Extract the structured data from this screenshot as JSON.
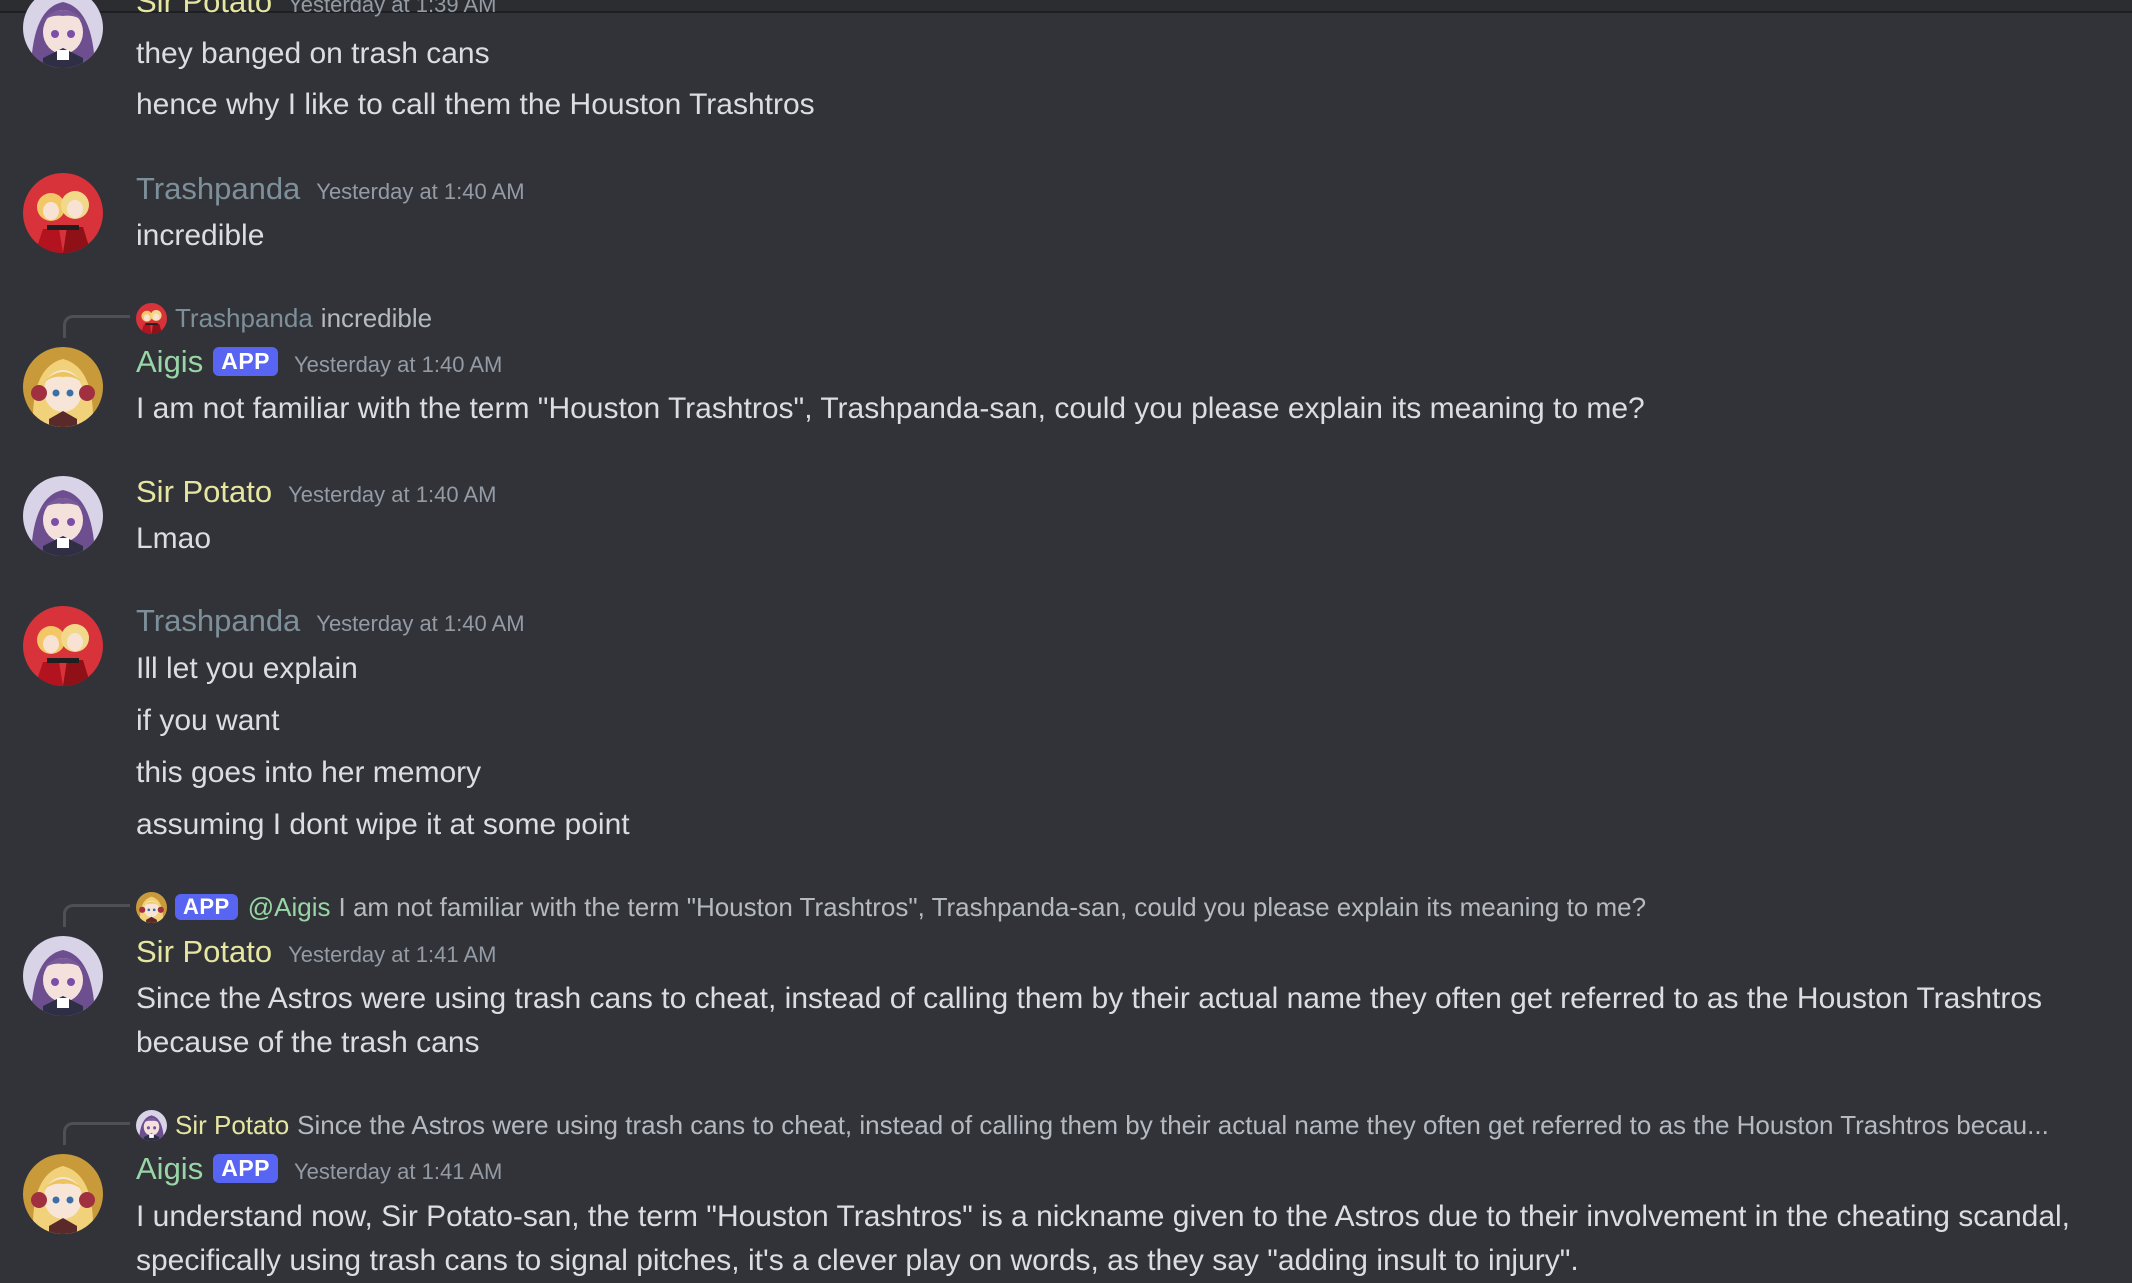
{
  "messages": [
    {
      "author": "Sir Potato",
      "time": "Yesterday at 1:39 AM",
      "lines": [
        "they banged on trash cans",
        "hence why I like to call them the Houston Trashtros"
      ]
    },
    {
      "author": "Trashpanda",
      "time": "Yesterday at 1:40 AM",
      "lines": [
        "incredible"
      ]
    },
    {
      "reply": {
        "author": "Trashpanda",
        "text": "incredible"
      },
      "author": "Aigis",
      "badge": "APP",
      "time": "Yesterday at 1:40 AM",
      "lines": [
        "I am not familiar with the term \"Houston Trashtros\", Trashpanda-san, could you please explain its meaning to me?"
      ]
    },
    {
      "author": "Sir Potato",
      "time": "Yesterday at 1:40 AM",
      "lines": [
        "Lmao"
      ]
    },
    {
      "author": "Trashpanda",
      "time": "Yesterday at 1:40 AM",
      "lines": [
        "Ill let you explain",
        "if you want",
        "this goes into her memory",
        "assuming I dont wipe it at some point"
      ]
    },
    {
      "reply": {
        "badge": "APP",
        "author": "@Aigis",
        "text": "I am not familiar with the term \"Houston Trashtros\", Trashpanda-san, could you please explain its meaning to me?"
      },
      "author": "Sir Potato",
      "time": "Yesterday at 1:41 AM",
      "lines": [
        "Since the Astros were using trash cans to cheat, instead of calling them by their actual name they often get referred to as the Houston Trashtros",
        "because of the trash cans"
      ]
    },
    {
      "reply": {
        "author": "Sir Potato",
        "text": "Since the Astros were using trash cans to cheat, instead of calling them by their actual name they often get referred to as the Houston Trashtros becau..."
      },
      "author": "Aigis",
      "badge": "APP",
      "time": "Yesterday at 1:41 AM",
      "lines": [
        "I understand now, Sir Potato-san, the term \"Houston Trashtros\" is a nickname given to the Astros due to their involvement in the cheating scandal,",
        "specifically using trash cans to signal pitches, it's a clever play on words, as they say \"adding insult to injury\"."
      ]
    }
  ],
  "colors": {
    "background": "#323339",
    "text": "#dbdee1",
    "timestamp": "#949ba4",
    "sir_potato_name": "#e6e6a0",
    "trashpanda_name": "#7d8f99",
    "aigis_name": "#99d6a6",
    "app_badge": "#5865f2"
  },
  "icons": {
    "sir_potato_avatar": "anime-girl-purple-hair-avatar",
    "trashpanda_avatar": "anime-duo-red-avatar",
    "aigis_avatar": "anime-girl-blonde-headphones-avatar"
  }
}
